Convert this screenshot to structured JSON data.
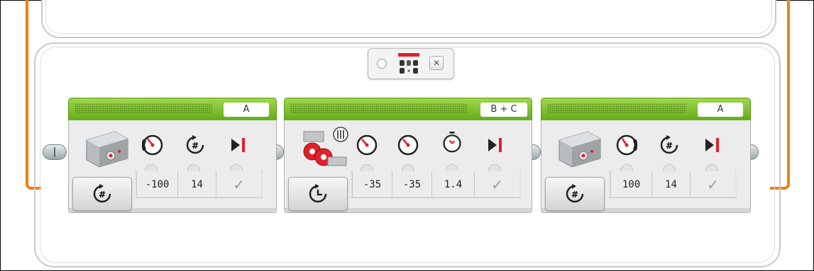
{
  "blocks": [
    {
      "port": "A",
      "mode": "rotations",
      "params": {
        "power": "-100",
        "rotations": "14"
      }
    },
    {
      "port": "B + C",
      "mode": "seconds",
      "params": {
        "power_left": "-35",
        "power_right": "-35",
        "seconds": "1.4"
      }
    },
    {
      "port": "A",
      "mode": "rotations",
      "params": {
        "power": "100",
        "rotations": "14"
      }
    }
  ],
  "icons": {
    "accent_green": "#7bc22a",
    "accent_orange": "#ef7f1a",
    "brake_red": "#e0202a"
  }
}
